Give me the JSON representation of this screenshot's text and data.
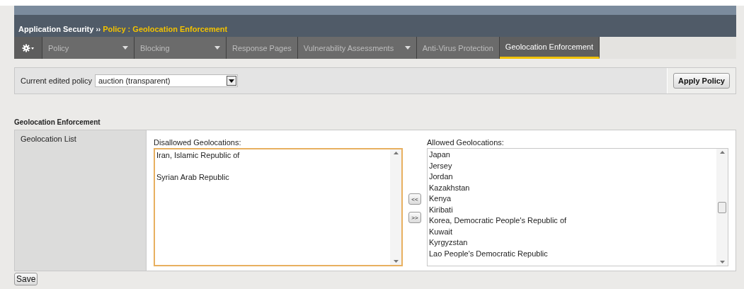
{
  "breadcrumb": {
    "section": "Application Security",
    "separator": "››",
    "page": "Policy : Geolocation Enforcement"
  },
  "tabs": [
    {
      "label": "Policy",
      "dropdown": true,
      "selected": false
    },
    {
      "label": "Blocking",
      "dropdown": true,
      "selected": false
    },
    {
      "label": "Response Pages",
      "dropdown": false,
      "selected": false
    },
    {
      "label": "Vulnerability Assessments",
      "dropdown": true,
      "selected": false
    },
    {
      "label": "Anti-Virus Protection",
      "dropdown": false,
      "selected": false
    },
    {
      "label": "Geolocation Enforcement",
      "dropdown": false,
      "selected": true
    }
  ],
  "policy_bar": {
    "label": "Current edited policy",
    "value": "auction (transparent)",
    "apply_button": "Apply Policy"
  },
  "section_title": "Geolocation Enforcement",
  "row_label": "Geolocation List",
  "disallowed": {
    "label": "Disallowed Geolocations:",
    "items": [
      "Iran, Islamic Republic of",
      "Syrian Arab Republic"
    ]
  },
  "move_buttons": [
    "<<",
    ">>"
  ],
  "allowed": {
    "label": "Allowed Geolocations:",
    "items": [
      "Japan",
      "Jersey",
      "Jordan",
      "Kazakhstan",
      "Kenya",
      "Kiribati",
      "Korea, Democratic People's Republic of",
      "Kuwait",
      "Kyrgyzstan",
      "Lao People's Democratic Republic"
    ]
  },
  "save_button": "Save"
}
